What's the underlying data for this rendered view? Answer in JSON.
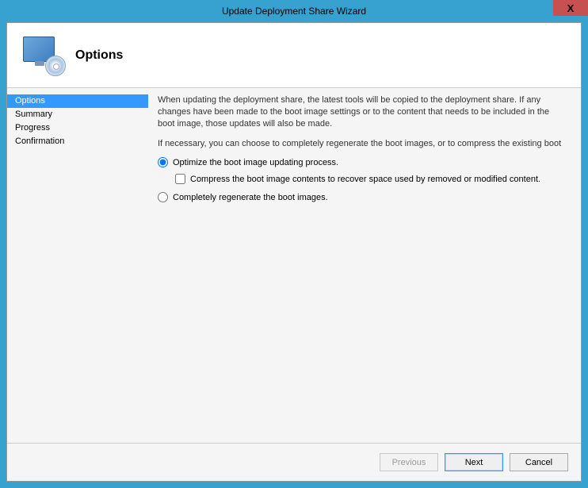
{
  "window": {
    "title": "Update Deployment Share Wizard",
    "close_glyph": "X"
  },
  "header": {
    "title": "Options"
  },
  "sidebar": {
    "items": [
      {
        "label": "Options",
        "selected": true
      },
      {
        "label": "Summary",
        "selected": false
      },
      {
        "label": "Progress",
        "selected": false
      },
      {
        "label": "Confirmation",
        "selected": false
      }
    ]
  },
  "content": {
    "para1": "When updating the deployment share, the latest tools will be copied to the deployment share.  If any changes have been made to the boot image settings or to the content that needs to be included in the boot image, those updates will also be made.",
    "para2": "If necessary, you can choose to completely regenerate the boot images, or to compress the existing boot",
    "radio_optimize": "Optimize the boot image updating process.",
    "checkbox_compress": "Compress the boot image contents to recover space used by removed or modified content.",
    "radio_regenerate": "Completely regenerate the boot images."
  },
  "footer": {
    "previous": "Previous",
    "next": "Next",
    "cancel": "Cancel"
  }
}
